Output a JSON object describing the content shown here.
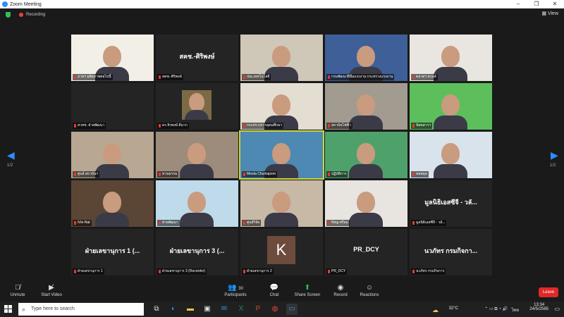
{
  "window": {
    "title": "Zoom Meeting",
    "controls": [
      "–",
      "❐",
      "✕"
    ]
  },
  "recording": {
    "label": "Recording"
  },
  "view_label": "View",
  "pager": {
    "left": "1/2",
    "right": "1/2"
  },
  "tiles": [
    {
      "name": "ภาคฯ ผลิตภาพต่อไปนี้",
      "bg": "#f2f0e6",
      "kind": "video"
    },
    {
      "name": "สคช.-ศิริพงษ์",
      "big": "สคช.-ศิริพงษ์",
      "bg": "#242424",
      "kind": "text"
    },
    {
      "name": "ปณ.เทคโนโลยี",
      "bg": "#cfc7b8",
      "kind": "video"
    },
    {
      "name": "กรมพัฒนาฝีมือแรงงาน กระทรวงแรงงาน",
      "bg": "#3e5f98",
      "kind": "video"
    },
    {
      "name": "ตลาดฯ ควอล์",
      "bg": "#e9e6e2",
      "kind": "video"
    },
    {
      "name": "สวทช. ฝ่ายพัฒนา",
      "bg": "#242424",
      "kind": "blank"
    },
    {
      "name": "ดร.จิรพงษ์ ดีมาก",
      "bg": "#242424",
      "kind": "photo"
    },
    {
      "name": "กระทรวงการอุดมศึกษา",
      "bg": "#e4ddd1",
      "kind": "video"
    },
    {
      "name": "สถาบันไฟฟ้า",
      "bg": "#a29b8f",
      "kind": "video"
    },
    {
      "name": "นิตยสารฯ",
      "bg": "#5cbf5c",
      "kind": "video"
    },
    {
      "name": "ศูนย์ สถาบันฯ",
      "bg": "#b7a793",
      "kind": "video"
    },
    {
      "name": "ทวนธรรม",
      "bg": "#9d8b7b",
      "kind": "video"
    },
    {
      "name": "Meeta Chunlaporn",
      "bg": "#4d89b3",
      "kind": "video",
      "active": true
    },
    {
      "name": "ปฏิบัติการ",
      "bg": "#4fa16b",
      "kind": "video"
    },
    {
      "name": "หอสมุด",
      "bg": "#d9e3ec",
      "kind": "video"
    },
    {
      "name": "iVie-Nat",
      "bg": "#5b4636",
      "kind": "video"
    },
    {
      "name": "ฝ่ายพัฒนา",
      "bg": "#bfdbeb",
      "kind": "video"
    },
    {
      "name": "ศูนย์วิจัย",
      "bg": "#c7b9a6",
      "kind": "video"
    },
    {
      "name": "Ning ศรีลม",
      "bg": "#e8e4df",
      "kind": "video"
    },
    {
      "name": "มูลนิธิเอสซีจี - วลั...",
      "big": "มูลนิธิเอสซีจี - วลั...",
      "bg": "#242424",
      "kind": "text"
    },
    {
      "name": "ฝ่ายเลขานุการ 1",
      "big": "ฝ่ายเลขานุการ 1 (...",
      "bg": "#242424",
      "kind": "text"
    },
    {
      "name": "ฝ่ายเลขานุการ 3 (Recorder)",
      "big": "ฝ่ายเลขานุการ 3 (...",
      "bg": "#242424",
      "kind": "text"
    },
    {
      "name": "ฝ่ายเลขานุการ 2",
      "big": "K",
      "bg": "#242424",
      "kind": "avatar"
    },
    {
      "name": "PR_DCY",
      "big": "PR_DCY",
      "bg": "#242424",
      "kind": "text"
    },
    {
      "name": "นวภัทร กรมกิจการ",
      "big": "นวภัทร กรมกิจกา...",
      "bg": "#242424",
      "kind": "text"
    }
  ],
  "toolbar": {
    "unmute": "Unmute",
    "start_video": "Start Video",
    "participants": "Participants",
    "participants_count": "30",
    "chat": "Chat",
    "share_screen": "Share Screen",
    "record": "Record",
    "reactions": "Reactions",
    "leave": "Leave"
  },
  "taskbar": {
    "search_placeholder": "Type here to search",
    "weather": "32°C",
    "lang": "ไทย",
    "time": "13:34",
    "date": "24/5/2565"
  },
  "colors": {
    "accent": "#2d8cff",
    "leave": "#e02828",
    "active_outline": "#c8d63a",
    "share": "#2fbf5b"
  }
}
